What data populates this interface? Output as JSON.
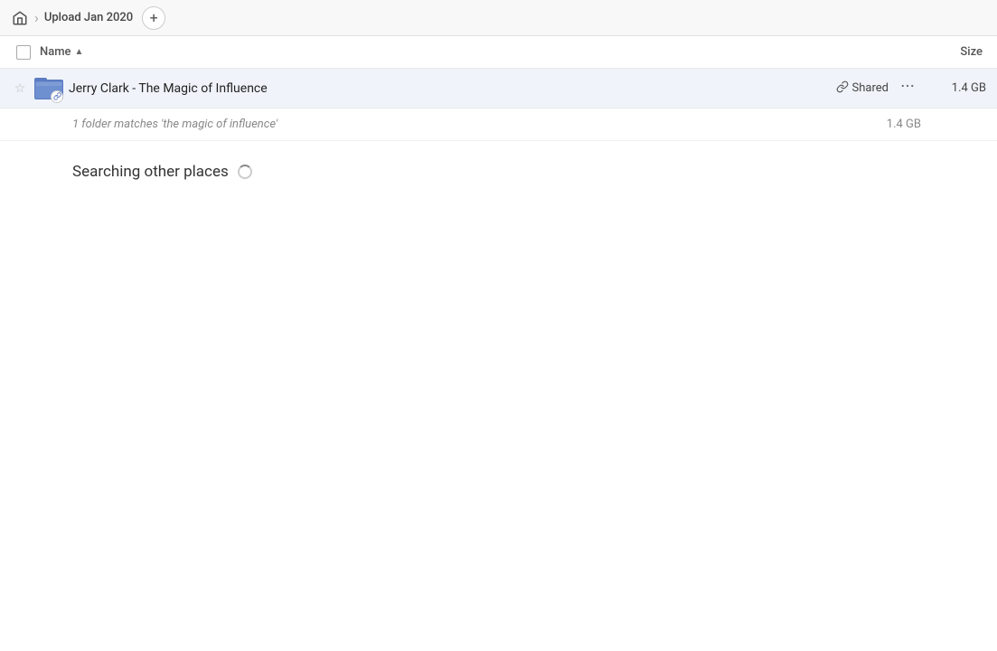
{
  "header": {
    "home_icon": "home",
    "breadcrumb_separator": "›",
    "tab_label": "Upload Jan 2020",
    "add_tab_label": "+"
  },
  "columns": {
    "name_label": "Name",
    "sort_indicator": "▲",
    "size_label": "Size"
  },
  "file_row": {
    "name": "Jerry Clark - The Magic of Influence",
    "shared_label": "Shared",
    "size": "1.4 GB",
    "star_icon": "☆",
    "link_icon": "🔗",
    "more_icon": "···"
  },
  "match_info": {
    "text": "1 folder matches 'the magic of influence'",
    "size": "1.4 GB"
  },
  "searching": {
    "label": "Searching other places"
  },
  "colors": {
    "folder_blue": "#5c7bc2",
    "background_row": "#f0f4fa"
  }
}
